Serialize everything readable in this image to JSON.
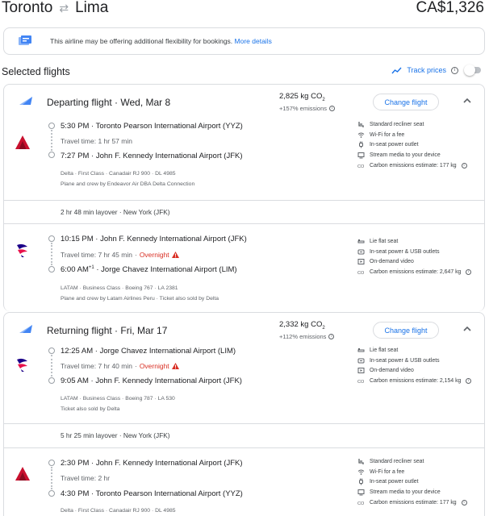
{
  "header": {
    "origin": "Toronto",
    "destination": "Lima",
    "price": "CA$1,326",
    "swap_icon": "arrows-swap-icon"
  },
  "banner": {
    "text": "This airline may be offering additional flexibility for bookings.",
    "link": "More details",
    "icon": "flexible-ticket-icon"
  },
  "selected": {
    "title": "Selected flights",
    "track_label": "Track prices"
  },
  "departing": {
    "title": "Departing flight · Wed, Mar 8",
    "co2": "2,825 kg CO",
    "co2_sub": "2",
    "emissions": "+157% emissions",
    "change_label": "Change flight",
    "segments": [
      {
        "airline_logo": "delta-logo",
        "dep_time": "5:30 PM",
        "dep_airport": "Toronto Pearson International Airport (YYZ)",
        "travel_time": "Travel time: 1 hr 57 min",
        "overnight": "",
        "arr_time": "7:27 PM",
        "arr_sup": "",
        "arr_airport": "John F. Kennedy International Airport (JFK)",
        "meta1": "Delta · First Class · Canadair RJ 900 · DL 4985",
        "meta2": "Plane and crew by Endeavor Air DBA Delta Connection",
        "amenities": [
          {
            "icon": "seat-icon",
            "label": "Standard recliner seat"
          },
          {
            "icon": "wifi-icon",
            "label": "Wi-Fi for a fee"
          },
          {
            "icon": "power-plug-icon",
            "label": "In-seat power outlet"
          },
          {
            "icon": "stream-media-icon",
            "label": "Stream media to your device"
          },
          {
            "icon": "co2-icon",
            "label": "Carbon emissions estimate: 177 kg"
          }
        ]
      },
      {
        "airline_logo": "latam-logo",
        "dep_time": "10:15 PM",
        "dep_airport": "John F. Kennedy International Airport (JFK)",
        "travel_time": "Travel time: 7 hr 45 min",
        "overnight": "Overnight",
        "arr_time": "6:00 AM",
        "arr_sup": "+1",
        "arr_airport": "Jorge Chavez International Airport (LIM)",
        "meta1": "LATAM · Business Class · Boeing 767 · LA 2381",
        "meta2": "Plane and crew by Latam Airlines Peru · Ticket also sold by Delta",
        "amenities": [
          {
            "icon": "lie-flat-seat-icon",
            "label": "Lie flat seat"
          },
          {
            "icon": "power-usb-icon",
            "label": "In-seat power & USB outlets"
          },
          {
            "icon": "on-demand-video-icon",
            "label": "On-demand video"
          },
          {
            "icon": "co2-icon",
            "label": "Carbon emissions estimate: 2,647 kg"
          }
        ]
      }
    ],
    "layover": "2 hr 48 min layover · New York (JFK)"
  },
  "returning": {
    "title": "Returning flight · Fri, Mar 17",
    "co2": "2,332 kg CO",
    "co2_sub": "2",
    "emissions": "+112% emissions",
    "change_label": "Change flight",
    "segments": [
      {
        "airline_logo": "latam-logo",
        "dep_time": "12:25 AM",
        "dep_airport": "Jorge Chavez International Airport (LIM)",
        "travel_time": "Travel time: 7 hr 40 min",
        "overnight": "Overnight",
        "arr_time": "9:05 AM",
        "arr_sup": "",
        "arr_airport": "John F. Kennedy International Airport (JFK)",
        "meta1": "LATAM · Business Class · Boeing 787 · LA 530",
        "meta2": "Ticket also sold by Delta",
        "amenities": [
          {
            "icon": "lie-flat-seat-icon",
            "label": "Lie flat seat"
          },
          {
            "icon": "power-usb-icon",
            "label": "In-seat power & USB outlets"
          },
          {
            "icon": "on-demand-video-icon",
            "label": "On-demand video"
          },
          {
            "icon": "co2-icon",
            "label": "Carbon emissions estimate: 2,154 kg"
          }
        ]
      },
      {
        "airline_logo": "delta-logo",
        "dep_time": "2:30 PM",
        "dep_airport": "John F. Kennedy International Airport (JFK)",
        "travel_time": "Travel time: 2 hr",
        "overnight": "",
        "arr_time": "4:30 PM",
        "arr_sup": "",
        "arr_airport": "Toronto Pearson International Airport (YYZ)",
        "meta1": "Delta · First Class · Canadair RJ 900 · DL 4985",
        "meta2": "",
        "amenities": [
          {
            "icon": "seat-icon",
            "label": "Standard recliner seat"
          },
          {
            "icon": "wifi-icon",
            "label": "Wi-Fi for a fee"
          },
          {
            "icon": "power-plug-icon",
            "label": "In-seat power outlet"
          },
          {
            "icon": "stream-media-icon",
            "label": "Stream media to your device"
          },
          {
            "icon": "co2-icon",
            "label": "Carbon emissions estimate: 177 kg"
          }
        ]
      }
    ],
    "layover": "5 hr 25 min layover · New York (JFK)"
  },
  "colors": {
    "accent": "#1a73e8",
    "warning": "#d93025",
    "delta_red": "#c8102e",
    "latam_indigo": "#1b0088",
    "latam_pink": "#e8114b"
  }
}
